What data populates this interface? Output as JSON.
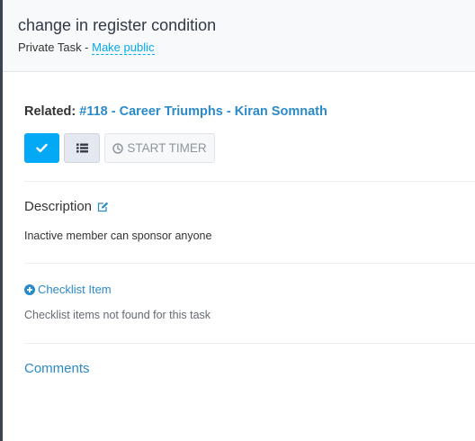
{
  "header": {
    "title": "change in register condition",
    "visibility_label": "Private Task - ",
    "make_public_label": "Make public"
  },
  "related": {
    "label": "Related: ",
    "link_text": "#118 - Career Triumphs - Kiran Somnath"
  },
  "toolbar": {
    "mark_complete_icon": "check-icon",
    "list_icon": "list-icon",
    "timer_icon": "clock-icon",
    "start_timer_label": "START TIMER"
  },
  "description": {
    "title": "Description",
    "edit_icon": "edit-icon",
    "text": "Inactive member can sponsor anyone"
  },
  "checklist": {
    "add_icon": "plus-circle-icon",
    "add_label": "Checklist Item",
    "empty_text": "Checklist items not found for this task"
  },
  "comments": {
    "label": "Comments"
  },
  "colors": {
    "accent": "#03a9f4",
    "link": "#2b8ac9",
    "header_bg": "#f8f9fa"
  }
}
